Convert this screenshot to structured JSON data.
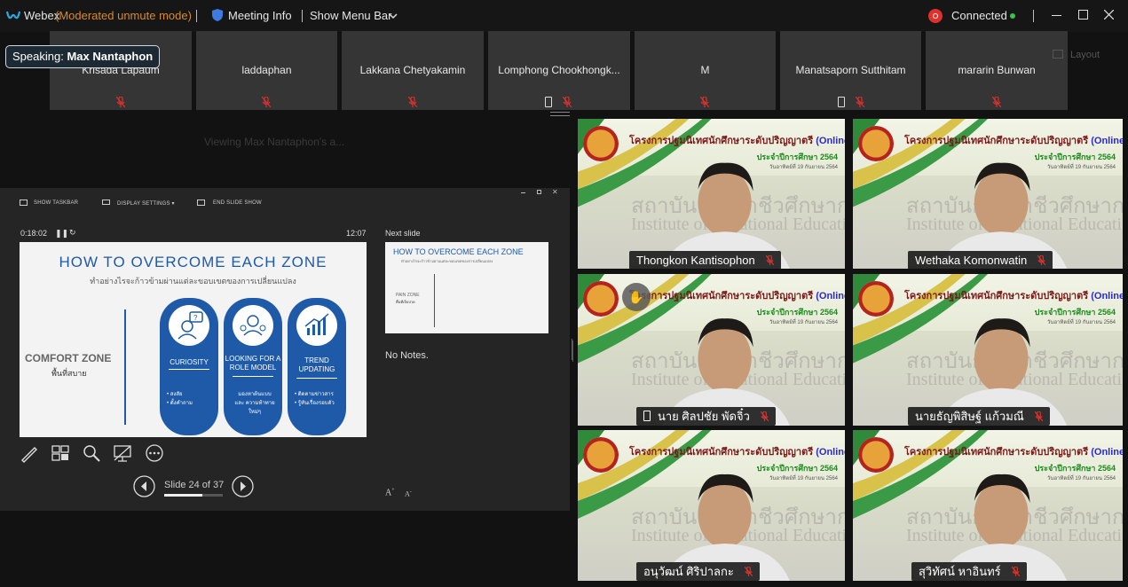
{
  "topbar": {
    "app_name": "Webex",
    "mode": "(Moderated unmute mode)",
    "meeting_info": "Meeting Info",
    "show_menu_bar": "Show Menu Bar",
    "connection_status": "Connected"
  },
  "speaking": {
    "label": "Speaking:",
    "name": "Max Nantaphon"
  },
  "participants_strip": [
    {
      "name": "Krisada Lapaum"
    },
    {
      "name": "laddaphan"
    },
    {
      "name": "Lakkana Chetyakamin"
    },
    {
      "name": "Lomphong Chookhongk..."
    },
    {
      "name": "M"
    },
    {
      "name": "Manatsaporn Sutthitam"
    },
    {
      "name": "mararin Bunwan"
    }
  ],
  "layout_button": "Layout",
  "viewing_text": "Viewing Max Nantaphon's a...",
  "presenter": {
    "toolbar": {
      "show_taskbar": "SHOW TASKBAR",
      "display_settings": "DISPLAY SETTINGS ▾",
      "end_slide_show": "END SLIDE SHOW"
    },
    "elapsed_time": "0:18:02",
    "clock": "12:07",
    "next_slide_label": "Next slide",
    "notes": "No Notes.",
    "slide_counter": "Slide 24 of 37",
    "slide_progress": 0.65,
    "current_slide": {
      "title": "HOW TO OVERCOME EACH ZONE",
      "subtitle": "ทำอย่างไรจะก้าวข้ามผ่านแต่ละขอบเขตของการเปลี่ยนแปลง",
      "comfort_zone": "COMFORT ZONE",
      "comfort_zone_th": "พื้นที่สบาย",
      "pills": [
        {
          "caption": "CURIOSITY",
          "items": [
            "• สงสัย",
            "• ตั้งคำถาม"
          ]
        },
        {
          "caption": "LOOKING FOR A ROLE MODEL",
          "items": [
            "มองหาต้นแบบ",
            "และ ความท้าทายใหม่ๆ"
          ]
        },
        {
          "caption": "TREND UPDATING",
          "items": [
            "• ติดตามข่าวสาร",
            "• รู้ทันเรื่องรอบตัว"
          ]
        }
      ]
    },
    "next_slide": {
      "title": "HOW TO OVERCOME EACH ZONE",
      "subtitle": "ทำอย่างไรจะก้าวข้ามผ่านแต่ละขอบเขตของการเปลี่ยนแปลง",
      "zone": "PAIN ZONE",
      "zone_th": "พื้นที่เจ็บปวด"
    }
  },
  "video_background": {
    "title": "โครงการปฐมนิเทศนักศึกษาระดับปริญญาตรี",
    "online": "(Online)",
    "year": "ประจำปีการศึกษา 2564",
    "date": "วันอาทิตย์ที่ 19 กันยายน 2564",
    "watermark_th": "สถาบันการอาชีวศึกษากรุงเทพมหานคร",
    "watermark_en": "Institute of Vocational Education, Bangkok"
  },
  "videos": [
    {
      "name": "Thongkon Kantisophon"
    },
    {
      "name": "Wethaka Komonwatin"
    },
    {
      "name": "นาย ศิลปชัย พัดจิ๋ว"
    },
    {
      "name": "นายธัญพิสิษฐ์ แก้วมณี"
    },
    {
      "name": "อนุวัฒน์ ศิริปาลกะ"
    },
    {
      "name": "สุวิทัศน์ หาอินทร์"
    }
  ],
  "colors": {
    "accent_blue": "#1f5aa8",
    "muted_red": "#e0302c",
    "connected_green": "#3fbf4f",
    "mode_orange": "#d98a2b"
  }
}
